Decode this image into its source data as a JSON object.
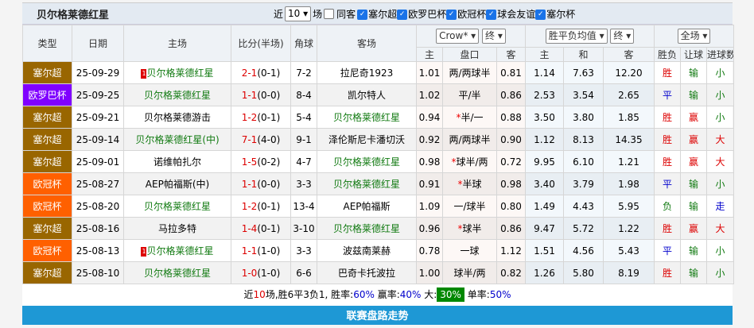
{
  "header": {
    "title": "贝尔格莱德红星",
    "recent_label": "近",
    "recent_count": "10",
    "matches_label": "场",
    "same_home_label": "同客",
    "competitions": [
      "塞尔超",
      "欧罗巴杯",
      "欧冠杯",
      "球会友谊",
      "塞尔杯"
    ],
    "same_home_checked": false
  },
  "columns": {
    "type": "类型",
    "date": "日期",
    "home": "主场",
    "score": "比分(半场)",
    "corner": "角球",
    "away": "客场",
    "company": "Crow*",
    "handicap_time": "终",
    "odds_type": "胜平负均值",
    "odds_time": "终",
    "range": "全场",
    "sub": [
      "主",
      "盘口",
      "客",
      "主",
      "和",
      "客",
      "胜负",
      "让球",
      "进球数"
    ]
  },
  "type_colors": {
    "塞尔超": "#996600",
    "欧罗巴杯": "#8000ff",
    "欧冠杯": "#ff6000"
  },
  "rows": [
    {
      "type": "塞尔超",
      "date": "25-09-29",
      "home": "贝尔格莱德红星",
      "home_tag": "1",
      "home_green": true,
      "ft": "2-1",
      "ht": "(0-1)",
      "corner": "7-2",
      "away": "拉尼奇1923",
      "away_green": false,
      "h": "1.01",
      "line": "两/两球半",
      "star": false,
      "a": "0.81",
      "o1": "1.14",
      "ox": "7.63",
      "o2": "12.20",
      "wl": "胜",
      "hc": "输",
      "ou": "小"
    },
    {
      "type": "欧罗巴杯",
      "date": "25-09-25",
      "home": "贝尔格莱德红星",
      "home_green": true,
      "ft": "1-1",
      "ht": "(0-0)",
      "corner": "8-4",
      "away": "凯尔特人",
      "h": "1.02",
      "line": "平/半",
      "a": "0.86",
      "o1": "2.53",
      "ox": "3.54",
      "o2": "2.65",
      "wl": "平",
      "hc": "输",
      "ou": "小"
    },
    {
      "type": "塞尔超",
      "date": "25-09-21",
      "home": "贝尔格莱德游击",
      "ft": "1-2",
      "ht": "(0-1)",
      "corner": "5-4",
      "away": "贝尔格莱德红星",
      "away_green": true,
      "h": "0.94",
      "line": "半/一",
      "star": true,
      "a": "0.88",
      "o1": "3.50",
      "ox": "3.80",
      "o2": "1.85",
      "wl": "胜",
      "hc": "赢",
      "ou": "小"
    },
    {
      "type": "塞尔超",
      "date": "25-09-14",
      "home": "贝尔格莱德红星(中)",
      "home_green": true,
      "ft": "7-1",
      "ht": "(4-0)",
      "corner": "9-1",
      "away": "泽伦斯尼卡潘切沃",
      "h": "0.92",
      "line": "两/两球半",
      "a": "0.90",
      "o1": "1.12",
      "ox": "8.13",
      "o2": "14.35",
      "wl": "胜",
      "hc": "赢",
      "ou": "大"
    },
    {
      "type": "塞尔超",
      "date": "25-09-01",
      "home": "诺维帕扎尔",
      "ft": "1-5",
      "ht": "(0-2)",
      "corner": "4-7",
      "away": "贝尔格莱德红星",
      "away_green": true,
      "h": "0.98",
      "line": "球半/两",
      "star": true,
      "a": "0.72",
      "o1": "9.95",
      "ox": "6.10",
      "o2": "1.21",
      "wl": "胜",
      "hc": "赢",
      "ou": "大"
    },
    {
      "type": "欧冠杯",
      "date": "25-08-27",
      "home": "AEP帕福斯(中)",
      "ft": "1-1",
      "ht": "(0-0)",
      "corner": "3-3",
      "away": "贝尔格莱德红星",
      "away_green": true,
      "h": "0.91",
      "line": "半球",
      "star": true,
      "a": "0.98",
      "o1": "3.40",
      "ox": "3.79",
      "o2": "1.98",
      "wl": "平",
      "hc": "输",
      "ou": "小"
    },
    {
      "type": "欧冠杯",
      "date": "25-08-20",
      "home": "贝尔格莱德红星",
      "home_green": true,
      "ft": "1-2",
      "ht": "(0-1)",
      "corner": "13-4",
      "away": "AEP帕福斯",
      "h": "1.09",
      "line": "一/球半",
      "a": "0.80",
      "o1": "1.49",
      "ox": "4.43",
      "o2": "5.95",
      "wl": "负",
      "hc": "输",
      "ou": "走"
    },
    {
      "type": "塞尔超",
      "date": "25-08-16",
      "home": "马拉多特",
      "ft": "1-4",
      "ht": "(0-1)",
      "corner": "3-10",
      "away": "贝尔格莱德红星",
      "away_green": true,
      "h": "0.96",
      "line": "球半",
      "star": true,
      "a": "0.86",
      "o1": "9.47",
      "ox": "5.72",
      "o2": "1.22",
      "wl": "胜",
      "hc": "赢",
      "ou": "大"
    },
    {
      "type": "欧冠杯",
      "date": "25-08-13",
      "home": "贝尔格莱德红星",
      "home_tag": "1",
      "home_green": true,
      "ft": "1-1",
      "ht": "(1-0)",
      "corner": "3-3",
      "away": "波兹南莱赫",
      "h": "0.78",
      "line": "一球",
      "a": "1.12",
      "o1": "1.51",
      "ox": "4.56",
      "o2": "5.43",
      "wl": "平",
      "hc": "输",
      "ou": "小"
    },
    {
      "type": "塞尔超",
      "date": "25-08-10",
      "home": "贝尔格莱德红星",
      "home_green": true,
      "ft": "1-0",
      "ht": "(1-0)",
      "corner": "6-6",
      "away": "巴奇卡托波拉",
      "h": "1.00",
      "line": "球半/两",
      "a": "0.82",
      "o1": "1.26",
      "ox": "5.80",
      "o2": "8.19",
      "wl": "胜",
      "hc": "输",
      "ou": "小"
    }
  ],
  "summary": {
    "p1": "近",
    "n": "10",
    "p2": "场,胜6平3负1, 胜率:",
    "win": "60%",
    "p3": " 赢率:",
    "cover": "40%",
    "p4": " 大:",
    "over": "30%",
    "p5": " 单率:",
    "odd": "50%"
  },
  "footer": {
    "title": "联赛盘路走势"
  }
}
